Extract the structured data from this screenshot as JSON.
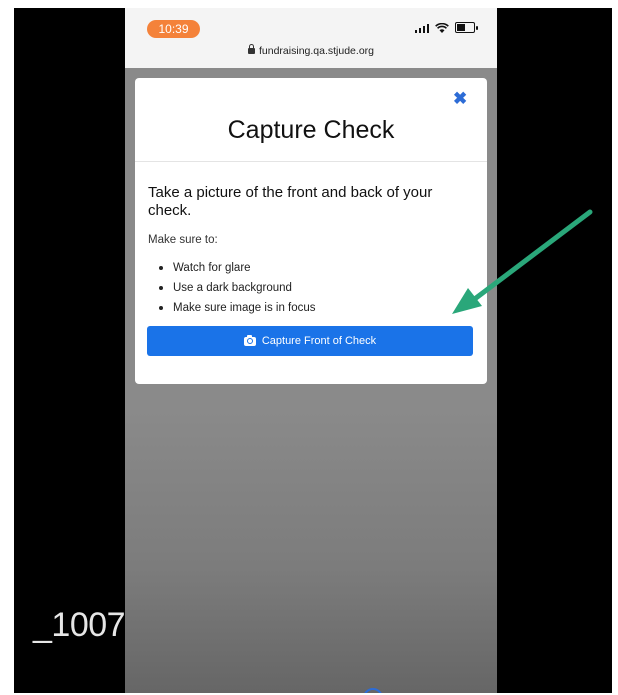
{
  "status_bar": {
    "time": "10:39",
    "url": "fundraising.qa.stjude.org"
  },
  "modal": {
    "close_glyph": "✖",
    "title": "Capture Check",
    "lead": "Take a picture of the front and back of your check.",
    "make_sure_label": "Make sure to:",
    "tips": [
      "Watch for glare",
      "Use a dark background",
      "Make sure image is in focus"
    ],
    "capture_button_label": "Capture Front of Check",
    "capture_button_icon": "camera-icon"
  },
  "overlay_label": "_1007",
  "colors": {
    "time_pill": "#f4823a",
    "primary_button": "#1a73e8",
    "annotation_arrow": "#2aa77a",
    "close_icon": "#2d6cd6"
  }
}
